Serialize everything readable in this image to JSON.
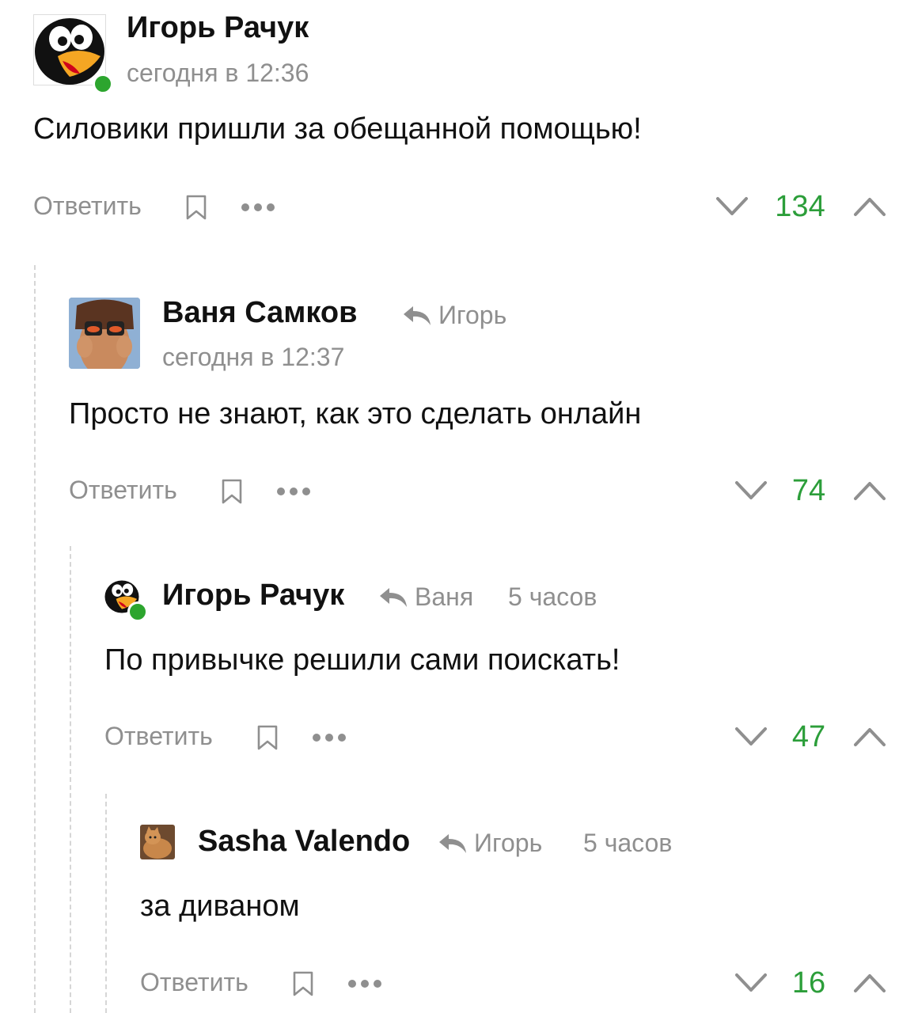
{
  "comments": [
    {
      "author": "Игорь Рачук",
      "time": "сегодня в 12:36",
      "text": "Силовики пришли за обещанной помощью!",
      "reply_label": "Ответить",
      "score": "134",
      "avatar_icon": "penguin-avatar",
      "online": true
    },
    {
      "author": "Ваня Самков",
      "reply_to": "Игорь",
      "time": "сегодня в 12:37",
      "text": "Просто не знают, как это сделать онлайн",
      "reply_label": "Ответить",
      "score": "74",
      "avatar_icon": "binoculars-avatar"
    },
    {
      "author": "Игорь Рачук",
      "reply_to": "Ваня",
      "time": "5 часов",
      "text": "По привычке решили сами поискать!",
      "reply_label": "Ответить",
      "score": "47",
      "avatar_icon": "penguin-avatar",
      "online": true
    },
    {
      "author": "Sasha Valendo",
      "reply_to": "Игорь",
      "time": "5 часов",
      "text": "за диваном",
      "reply_label": "Ответить",
      "score": "16",
      "avatar_icon": "cat-avatar"
    }
  ],
  "colors": {
    "score": "#2c9e3a",
    "muted": "#8f8f8f",
    "online": "#2ca52e"
  }
}
